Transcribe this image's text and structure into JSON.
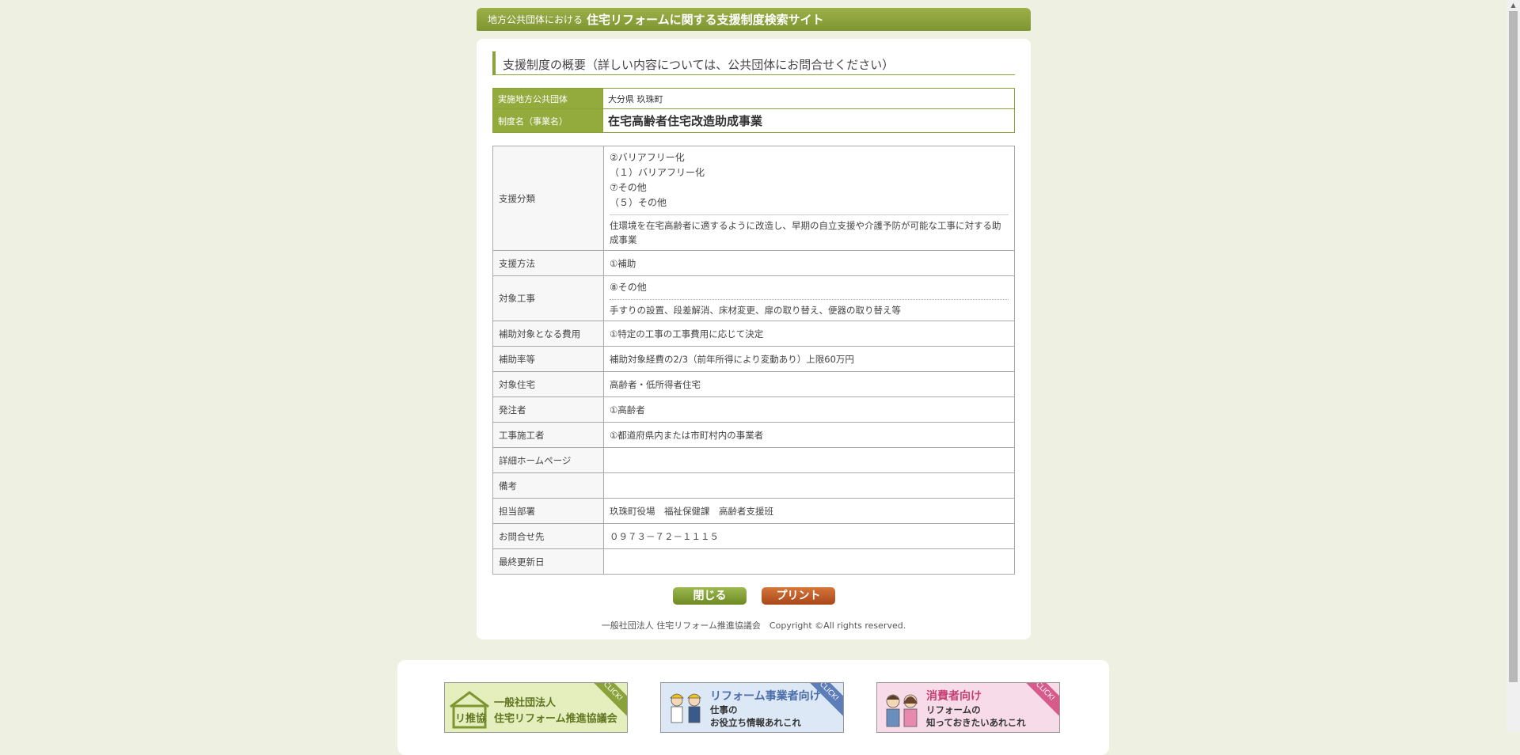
{
  "header": {
    "prefix": "地方公共団体における",
    "title": "住宅リフォームに関する支援制度検索サイト"
  },
  "section_title": "支援制度の概要（詳しい内容については、公共団体にお問合せください）",
  "summary": {
    "municipality_label": "実施地方公共団体",
    "municipality_value": "大分県 玖珠町",
    "program_label": "制度名（事業名）",
    "program_value": "在宅高齢者住宅改造助成事業"
  },
  "details": {
    "category": {
      "label": "支援分類",
      "lines": [
        "②バリアフリー化",
        "（１）バリアフリー化",
        "⑦その他",
        "（５）その他"
      ],
      "description": "住環境を在宅高齢者に適するように改造し、早期の自立支援や介護予防が可能な工事に対する助成事業"
    },
    "method": {
      "label": "支援方法",
      "value": "①補助"
    },
    "works": {
      "label": "対象工事",
      "value": "⑧その他",
      "note": "手すりの設置、段差解消、床材変更、扉の取り替え、便器の取り替え等"
    },
    "cost": {
      "label": "補助対象となる費用",
      "value": "①特定の工事の工事費用に応じて決定"
    },
    "rate": {
      "label": "補助率等",
      "value": "補助対象経費の2/3（前年所得により変動あり）上限60万円"
    },
    "housing": {
      "label": "対象住宅",
      "value": "高齢者・低所得者住宅"
    },
    "orderer": {
      "label": "発注者",
      "value": "①高齢者"
    },
    "contractor": {
      "label": "工事施工者",
      "value": "①都道府県内または市町村内の事業者"
    },
    "homepage": {
      "label": "詳細ホームページ",
      "value": ""
    },
    "remarks": {
      "label": "備考",
      "value": ""
    },
    "department": {
      "label": "担当部署",
      "value": "玖珠町役場　福祉保健課　高齢者支援班"
    },
    "contact": {
      "label": "お問合せ先",
      "value": "０９７３－７２－１１１５"
    },
    "updated": {
      "label": "最終更新日",
      "value": ""
    }
  },
  "buttons": {
    "close": "閉じる",
    "print": "プリント"
  },
  "copyright": "一般社団法人 住宅リフォーム推進協議会　Copyright ©All rights reserved.",
  "footer": {
    "banner1": {
      "badge": "CLICK!",
      "logo": "リ推協",
      "line1": "一般社団法人",
      "line2": "住宅リフォーム推進協議会"
    },
    "banner2": {
      "badge": "CLICK!",
      "title": "リフォーム事業者向け",
      "line1": "仕事の",
      "line2": "お役立ち情報あれこれ"
    },
    "banner3": {
      "badge": "CLICK!",
      "title": "消費者向け",
      "line1": "リフォームの",
      "line2": "知っておきたいあれこれ"
    }
  },
  "colors": {
    "accent": "#8aa23a",
    "page_bg": "#eef0e2",
    "print_button": "#c0602a"
  }
}
